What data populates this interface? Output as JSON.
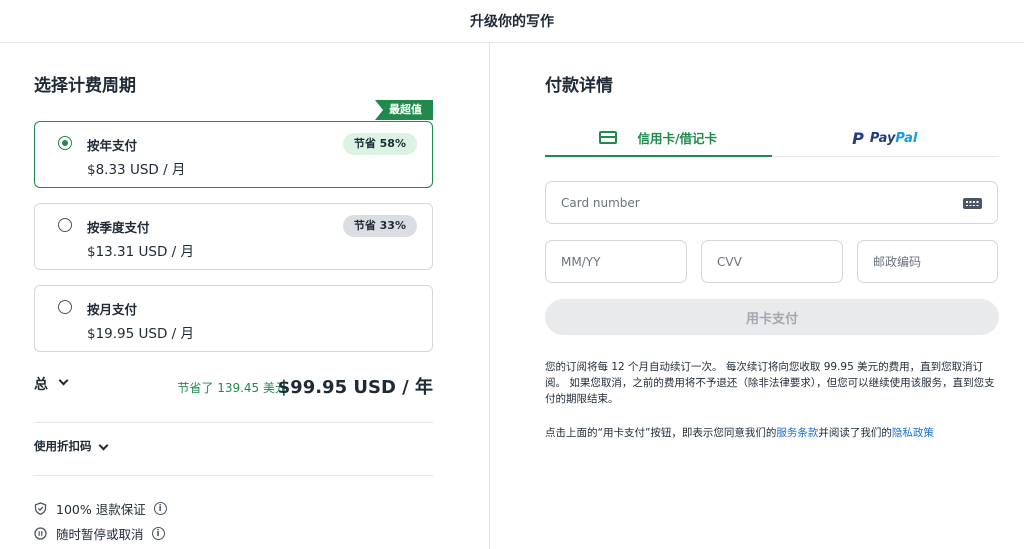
{
  "header": {
    "title": "升级你的写作"
  },
  "billing": {
    "title": "选择计费周期",
    "best_value_tag": "最超值",
    "plans": [
      {
        "name": "按年支付",
        "price": "$8.33 USD / 月",
        "badge": "节省 58%",
        "selected": true
      },
      {
        "name": "按季度支付",
        "price": "$13.31 USD / 月",
        "badge": "节省 33%",
        "selected": false
      },
      {
        "name": "按月支付",
        "price": "$19.95 USD / 月",
        "badge": "",
        "selected": false
      }
    ],
    "total_label": "总",
    "saved_text": "节省了 139.45 美元",
    "total_price": "$99.95 USD / 年",
    "discount_label": "使用折扣码",
    "guarantees": [
      {
        "text": "100% 退款保证",
        "icon": "shield-check-icon"
      },
      {
        "text": "随时暂停或取消",
        "icon": "pause-icon"
      }
    ]
  },
  "payment": {
    "title": "付款详情",
    "tabs": {
      "card": "信用卡/借记卡",
      "paypal_pay": "Pay",
      "paypal_pal": "Pal"
    },
    "fields": {
      "card_number_placeholder": "Card number",
      "expiry_placeholder": "MM/YY",
      "cvv_placeholder": "CVV",
      "zip_placeholder": "邮政编码"
    },
    "pay_button": "用卡支付",
    "notice": "您的订阅将每 12 个月自动续订一次。 每次续订将向您收取 99.95 美元的费用，直到您取消订阅。 如果您取消，之前的费用将不予退还（除非法律要求），但您可以继续使用该服务，直到您支付的期限结束。",
    "terms_prefix": "点击上面的“用卡支付”按钮，即表示您同意我们的",
    "terms_link": "服务条款",
    "terms_middle": "并阅读了我们的",
    "privacy_link": "隐私政策"
  },
  "colors": {
    "accent": "#1f8a4c",
    "link": "#1670d0",
    "paypal_dark": "#253b80",
    "paypal_light": "#179bd7"
  }
}
